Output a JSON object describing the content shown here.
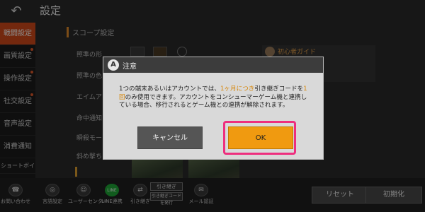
{
  "header": {
    "title": "設定"
  },
  "sidebar": {
    "items": [
      {
        "label": "戦闘設定",
        "active": true
      },
      {
        "label": "画質設定"
      },
      {
        "label": "操作設定"
      },
      {
        "label": "社交設定"
      },
      {
        "label": "音声設定"
      },
      {
        "label": "消費通知"
      },
      {
        "label": "ショートボイス"
      },
      {
        "label": "お問い合わせ"
      }
    ]
  },
  "content": {
    "section": "スコープ設定",
    "rows": [
      "照準の形",
      "照準の色",
      "エイムア",
      "命中通知",
      "瞬殺モー",
      "斜め撃ち"
    ],
    "guide_label": "初心者ガイド"
  },
  "bottom": {
    "lang": "言語設定",
    "user_center": "ユーザーセンター",
    "line_icon": "LINE",
    "line": "LINE連携",
    "transfer": "引き継ぎ",
    "transfer_btn": "引き継ぎ",
    "transfer_code_btn": "引き継ぎコードを発行",
    "mail": "メール認証",
    "reset": "リセット",
    "init": "初期化"
  },
  "modal": {
    "title": "注意",
    "logo_letter": "A",
    "body_1": "1つの端末あるいはアカウントでは、",
    "body_hl1": "1ヶ月につき",
    "body_2": "引き継ぎコードを",
    "body_hl2": "1回",
    "body_3": "のみ使用できます。アカウントをコンシューマーゲーム機と連携している場合、移行されるとゲーム機との連携が解除されます。",
    "cancel": "キャンセル",
    "ok": "OK"
  },
  "colors": {
    "accent_orange": "#f09a10",
    "highlight_pink": "#ee2f7e",
    "sidebar_active": "#d24a1a",
    "line_green": "#1fa838"
  }
}
